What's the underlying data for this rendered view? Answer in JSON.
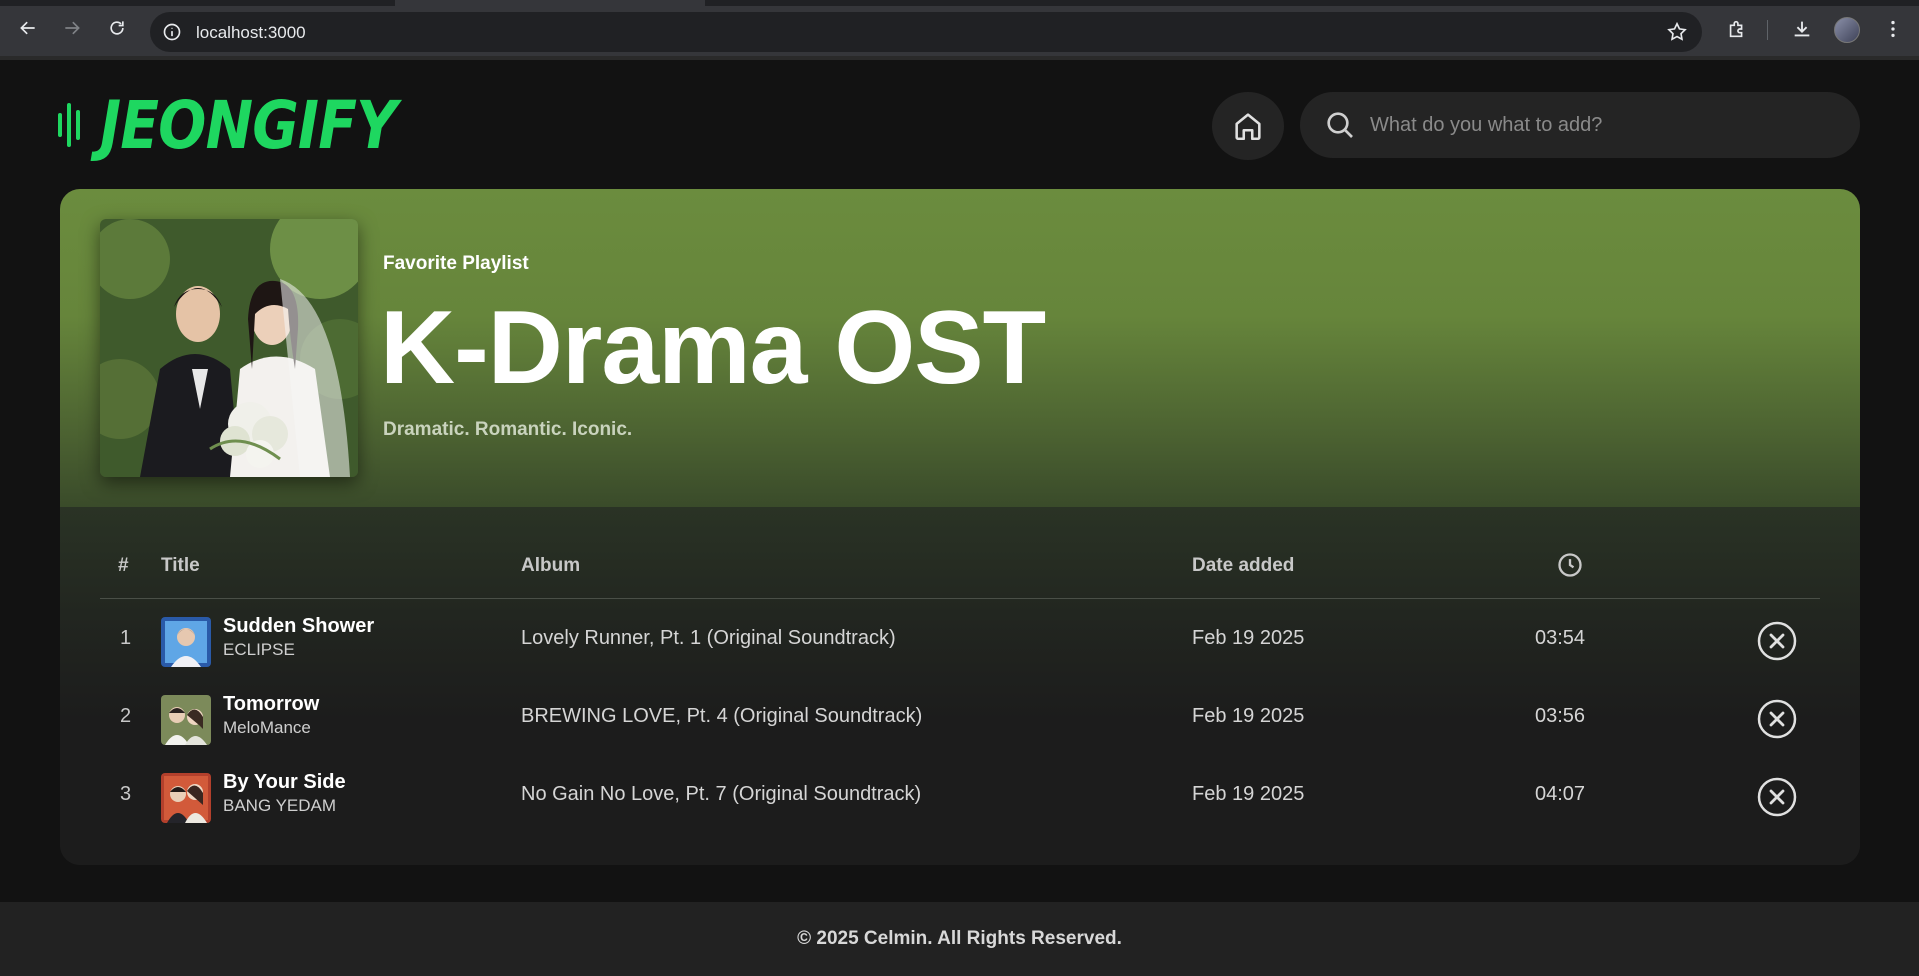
{
  "browser": {
    "url": "localhost:3000"
  },
  "app": {
    "logo_text": "JEONGIFY",
    "accent_color": "#1ed760"
  },
  "search": {
    "placeholder": "What do you what to add?"
  },
  "playlist": {
    "label": "Favorite Playlist",
    "title": "K-Drama OST",
    "description": "Dramatic. Romantic. Iconic.",
    "hero_color": "#6b8c3e"
  },
  "table": {
    "headers": {
      "number": "#",
      "title": "Title",
      "album": "Album",
      "date_added": "Date added",
      "duration_icon": "clock-icon"
    },
    "rows": [
      {
        "num": "1",
        "title": "Sudden Shower",
        "artist": "ECLIPSE",
        "album": "Lovely Runner, Pt. 1 (Original Soundtrack)",
        "date": "Feb 19 2025",
        "duration": "03:54"
      },
      {
        "num": "2",
        "title": "Tomorrow",
        "artist": "MeloMance",
        "album": "BREWING LOVE, Pt. 4 (Original Soundtrack)",
        "date": "Feb 19 2025",
        "duration": "03:56"
      },
      {
        "num": "3",
        "title": "By Your Side",
        "artist": "BANG YEDAM",
        "album": "No Gain No Love, Pt. 7 (Original Soundtrack)",
        "date": "Feb 19 2025",
        "duration": "04:07"
      }
    ]
  },
  "footer": {
    "text": "© 2025 Celmin. All Rights Reserved."
  }
}
